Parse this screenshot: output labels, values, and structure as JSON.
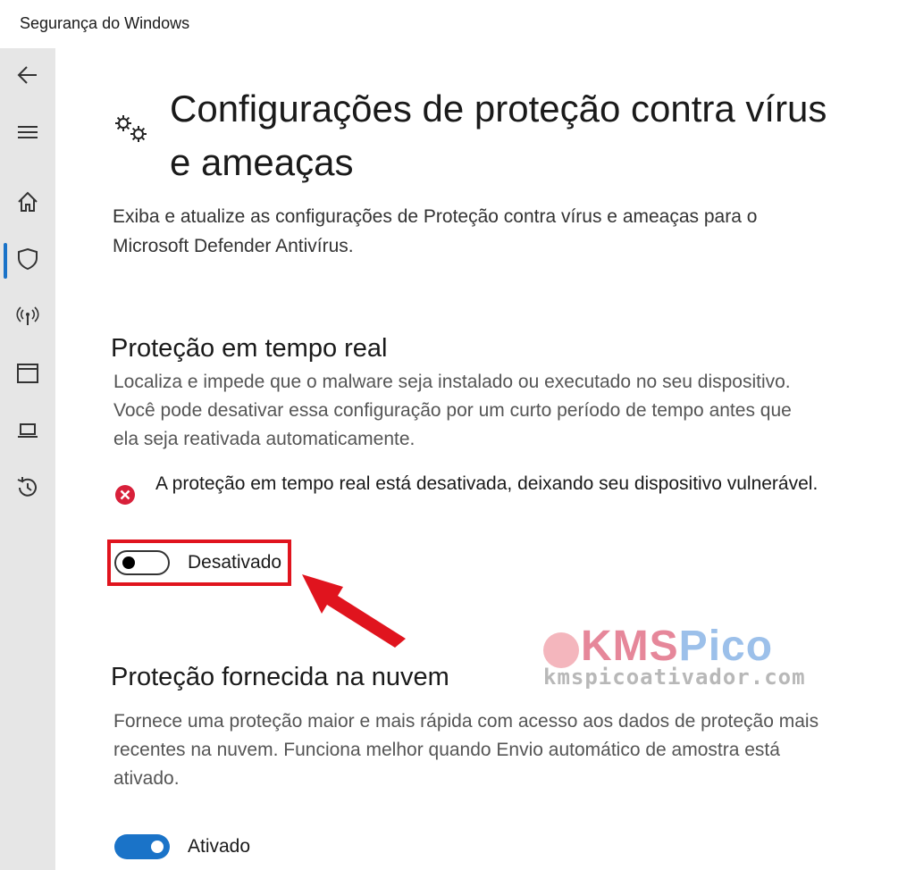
{
  "window": {
    "title": "Segurança do Windows"
  },
  "sidebar": {
    "items": [
      {
        "name": "back",
        "icon": "back-arrow-icon"
      },
      {
        "name": "menu",
        "icon": "hamburger-icon"
      },
      {
        "name": "home",
        "icon": "home-icon"
      },
      {
        "name": "virus-protection",
        "icon": "shield-icon",
        "active": true
      },
      {
        "name": "firewall",
        "icon": "wifi-antenna-icon"
      },
      {
        "name": "app-browser",
        "icon": "browser-window-icon"
      },
      {
        "name": "device-security",
        "icon": "laptop-icon"
      },
      {
        "name": "protection-history",
        "icon": "history-icon"
      }
    ],
    "accent_color": "#1a73c8"
  },
  "page": {
    "icon": "gears-icon",
    "title": "Configurações de proteção contra vírus e ameaças",
    "description": "Exiba e atualize as configurações de Proteção contra vírus e ameaças para o Microsoft Defender Antivírus."
  },
  "realtime": {
    "title": "Proteção em tempo real",
    "description": "Localiza e impede que o malware seja instalado ou executado no seu dispositivo. Você pode desativar essa configuração por um curto período de tempo antes que ela seja reativada automaticamente.",
    "alert_icon": "error-x-icon",
    "alert_text": "A proteção em tempo real está desativada, deixando seu dispositivo vulnerável.",
    "toggle_state": "off",
    "toggle_label": "Desativado",
    "highlight_color": "#e0141e"
  },
  "cloud": {
    "title": "Proteção fornecida na nuvem",
    "description": "Fornece uma proteção maior e mais rápida com acesso aos dados de proteção mais recentes na nuvem. Funciona melhor quando Envio automático de amostra está ativado.",
    "toggle_state": "on",
    "toggle_label": "Ativado"
  },
  "watermark": {
    "logo_part1": "KMS",
    "logo_part2": "Pico",
    "url": "kmspicoativador.com"
  }
}
